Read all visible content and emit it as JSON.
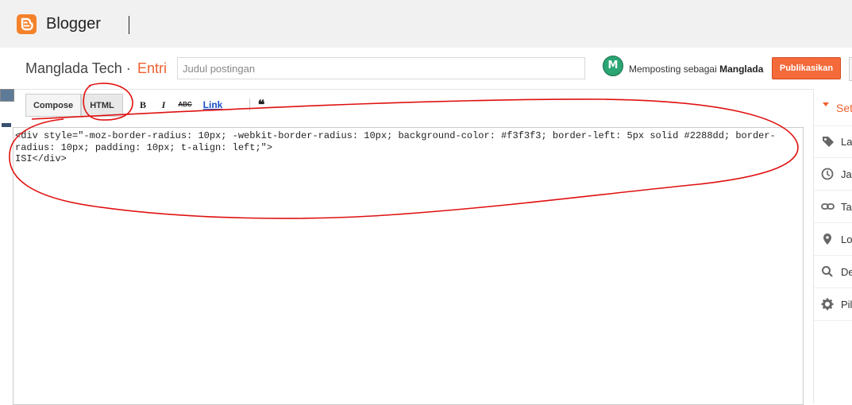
{
  "app": {
    "name": "Blogger"
  },
  "header": {
    "blog_name": "Manglada Tech",
    "separator": "·",
    "section": "Entri",
    "title_placeholder": "Judul postingan",
    "avatar_letter": "M",
    "posting_as_prefix": "Memposting sebagai",
    "posting_as_user": "Manglada",
    "publish_label": "Publikasikan"
  },
  "toolbar": {
    "compose_label": "Compose",
    "html_label": "HTML",
    "bold_label": "B",
    "italic_label": "I",
    "strike_label": "ABC",
    "link_label": "Link",
    "quote_label": "❝"
  },
  "editor": {
    "content": "<div style=\"-moz-border-radius: 10px; -webkit-border-radius: 10px; background-color: #f3f3f3; border-left: 5px solid #2288dd; border-radius: 10px; padding: 10px; t-align: left;\">\nISI</div>"
  },
  "sidebar": {
    "header_label": "Set",
    "items": [
      {
        "icon": "label-icon",
        "label": "La"
      },
      {
        "icon": "clock-icon",
        "label": "Ja"
      },
      {
        "icon": "link-icon",
        "label": "Ta"
      },
      {
        "icon": "location-icon",
        "label": "Lo"
      },
      {
        "icon": "search-icon",
        "label": "De"
      },
      {
        "icon": "gear-icon",
        "label": "Pil"
      }
    ]
  },
  "colors": {
    "brand_orange": "#f5822a",
    "accent_orange": "#ef5f2f",
    "publish_button": "#f46a3a",
    "avatar_green": "#2aa573",
    "annotation_red": "#e01010"
  }
}
